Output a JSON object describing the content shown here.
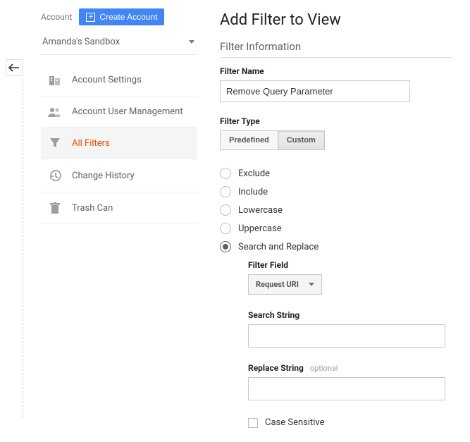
{
  "sidebar": {
    "account_label": "Account",
    "create_button": "Create Account",
    "account_picker": "Amanda's Sandbox",
    "items": [
      {
        "label": "Account Settings"
      },
      {
        "label": "Account User Management"
      },
      {
        "label": "All Filters"
      },
      {
        "label": "Change History"
      },
      {
        "label": "Trash Can"
      }
    ]
  },
  "main": {
    "title": "Add Filter to View",
    "section_title": "Filter Information",
    "filter_name_label": "Filter Name",
    "filter_name_value": "Remove Query Parameter",
    "filter_type_label": "Filter Type",
    "tabs": {
      "predefined": "Predefined",
      "custom": "Custom"
    },
    "radios": {
      "exclude": "Exclude",
      "include": "Include",
      "lowercase": "Lowercase",
      "uppercase": "Uppercase",
      "search_replace": "Search and Replace"
    },
    "filter_field_label": "Filter Field",
    "filter_field_value": "Request URI",
    "search_string_label": "Search String",
    "search_string_value": "",
    "replace_string_label": "Replace String",
    "optional_text": "optional",
    "replace_string_value": "",
    "case_sensitive_label": "Case Sensitive"
  }
}
